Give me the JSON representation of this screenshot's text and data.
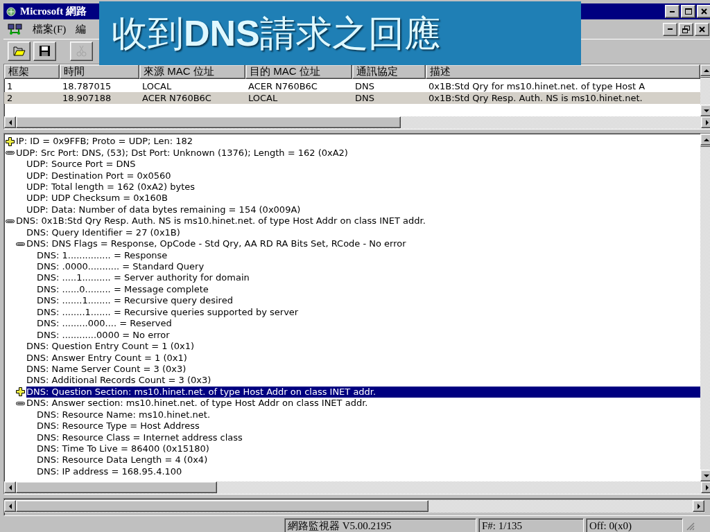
{
  "window": {
    "title": "Microsoft 網路"
  },
  "slide_title": "收到**DNS**請求之回應",
  "menu": [
    "檔案(F)",
    "編"
  ],
  "toolbar": [
    {
      "kind": "open",
      "disabled": false
    },
    {
      "kind": "save",
      "disabled": false
    },
    {
      "kind": "cut",
      "disabled": true
    }
  ],
  "frames": {
    "columns": [
      "框架",
      "時間",
      "來源 MAC 位址",
      "目的 MAC 位址",
      "通訊協定",
      "描述"
    ],
    "rows": [
      {
        "cells": [
          "1",
          "18.787015",
          "LOCAL",
          "ACER N760B6C",
          "DNS",
          "0x1B:Std Qry for ms10.hinet.net. of type Host A"
        ],
        "selected": false
      },
      {
        "cells": [
          "2",
          "18.907188",
          "ACER N760B6C",
          "LOCAL",
          "DNS",
          "0x1B:Std Qry Resp. Auth. NS is ms10.hinet.net."
        ],
        "selected": true
      }
    ]
  },
  "details": [
    {
      "text": "IP: ID = 0x9FFB; Proto = UDP; Len: 182",
      "expanded": false,
      "selected": false
    },
    {
      "text": "UDP: Src Port: DNS, (53); Dst Port: Unknown (1376); Length = 162 (0xA2)",
      "expanded": true,
      "selected": false,
      "children": [
        {
          "text": "UDP: Source Port = DNS",
          "selected": false
        },
        {
          "text": "UDP: Destination Port = 0x0560",
          "selected": false
        },
        {
          "text": "UDP: Total length = 162 (0xA2) bytes",
          "selected": false
        },
        {
          "text": "UDP: UDP Checksum = 0x160B",
          "selected": false
        },
        {
          "text": "UDP: Data: Number of data bytes remaining = 154 (0x009A)",
          "selected": false
        }
      ]
    },
    {
      "text": "DNS: 0x1B:Std Qry Resp. Auth. NS is ms10.hinet.net. of type Host Addr on class INET addr.",
      "expanded": true,
      "selected": false,
      "children": [
        {
          "text": "DNS: Query Identifier = 27 (0x1B)",
          "selected": false
        },
        {
          "text": "DNS: DNS Flags = Response, OpCode - Std Qry, AA RD RA Bits Set, RCode - No error",
          "expanded": true,
          "selected": false,
          "children": [
            {
              "text": "DNS: 1............... = Response",
              "selected": false
            },
            {
              "text": "DNS: .0000........... = Standard Query",
              "selected": false
            },
            {
              "text": "DNS: .....1.......... = Server authority for domain",
              "selected": false
            },
            {
              "text": "DNS: ......0......... = Message complete",
              "selected": false
            },
            {
              "text": "DNS: .......1........ = Recursive query desired",
              "selected": false
            },
            {
              "text": "DNS: ........1....... = Recursive queries supported by server",
              "selected": false
            },
            {
              "text": "DNS: .........000.... = Reserved",
              "selected": false
            },
            {
              "text": "DNS: ............0000 = No error",
              "selected": false
            }
          ]
        },
        {
          "text": "DNS: Question Entry Count = 1 (0x1)",
          "selected": false
        },
        {
          "text": "DNS: Answer Entry Count = 1 (0x1)",
          "selected": false
        },
        {
          "text": "DNS: Name Server Count = 3 (0x3)",
          "selected": false
        },
        {
          "text": "DNS: Additional Records Count = 3 (0x3)",
          "selected": false
        },
        {
          "text": "DNS: Question Section: ms10.hinet.net. of type Host Addr on class INET addr.",
          "expanded": false,
          "selected": true
        },
        {
          "text": "DNS: Answer section: ms10.hinet.net. of type Host Addr on class INET addr.",
          "expanded": true,
          "selected": false,
          "children": [
            {
              "text": "DNS: Resource Name: ms10.hinet.net.",
              "selected": false
            },
            {
              "text": "DNS: Resource Type = Host Address",
              "selected": false
            },
            {
              "text": "DNS: Resource Class = Internet address class",
              "selected": false
            },
            {
              "text": "DNS: Time To Live = 86400 (0x15180)",
              "selected": false
            },
            {
              "text": "DNS: Resource Data Length = 4 (0x4)",
              "selected": false
            },
            {
              "text": "DNS: IP address = 168.95.4.100",
              "selected": false
            }
          ]
        }
      ]
    }
  ],
  "status_bar": [
    "網路監視器 V5.00.2195",
    "F#: 1/135",
    "Off: 0(x0)"
  ]
}
